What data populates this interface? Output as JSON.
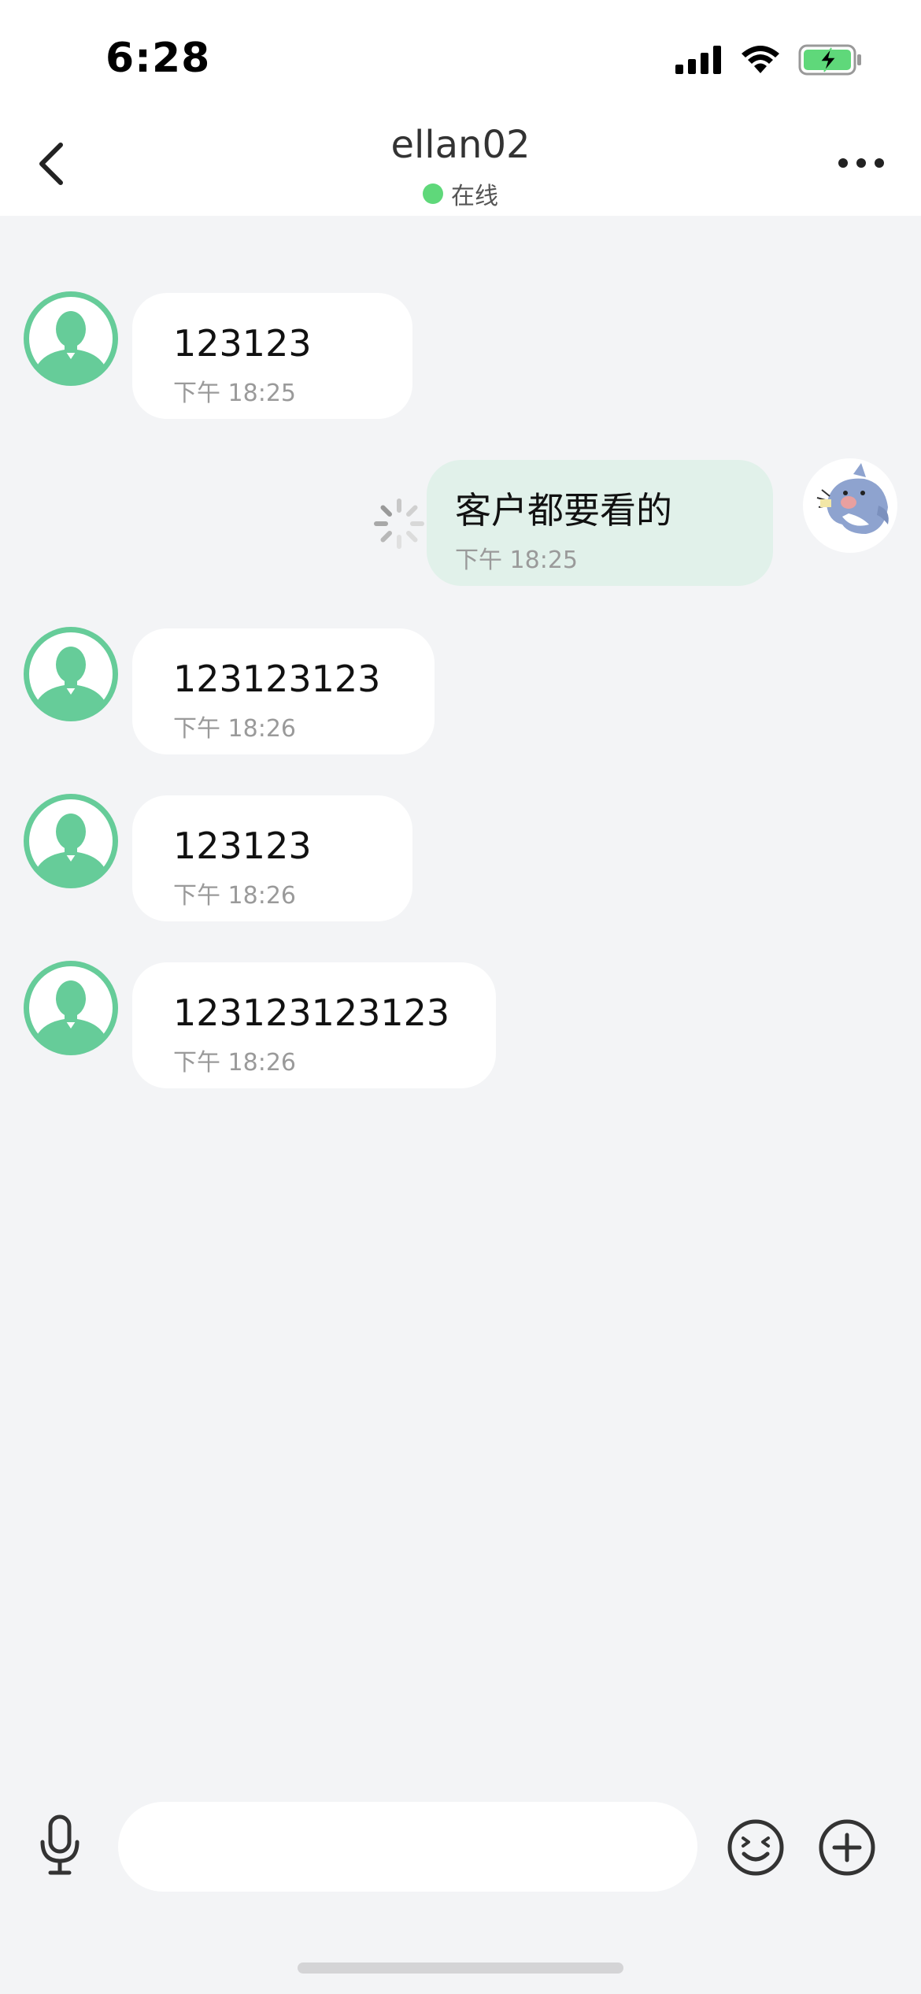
{
  "status_bar": {
    "time": "6:28",
    "icons": [
      "cellular-signal-icon",
      "wifi-icon",
      "battery-charging-icon"
    ]
  },
  "header": {
    "title": "ellan02",
    "status_text": "在线",
    "status_color": "#5fd87a",
    "back_icon": "chevron-left-icon",
    "more_icon": "more-dots-icon"
  },
  "messages": [
    {
      "direction": "incoming",
      "text": "123123",
      "time": "下午 18:25",
      "avatar": "default-user-avatar"
    },
    {
      "direction": "outgoing",
      "text": "客户都要看的",
      "time": "下午 18:25",
      "avatar": "shark-sticker-avatar",
      "sending": true
    },
    {
      "direction": "incoming",
      "text": "123123123",
      "time": "下午 18:26",
      "avatar": "default-user-avatar"
    },
    {
      "direction": "incoming",
      "text": "123123",
      "time": "下午 18:26",
      "avatar": "default-user-avatar"
    },
    {
      "direction": "incoming",
      "text": "123123123123",
      "time": "下午 18:26",
      "avatar": "default-user-avatar"
    }
  ],
  "composer": {
    "placeholder": "",
    "value": "",
    "voice_icon": "microphone-icon",
    "emoji_icon": "emoji-icon",
    "plus_icon": "plus-circle-icon"
  },
  "colors": {
    "background": "#f3f4f6",
    "incoming_bubble": "#ffffff",
    "outgoing_bubble": "#e1f1ea",
    "avatar_green": "#66cc99"
  }
}
